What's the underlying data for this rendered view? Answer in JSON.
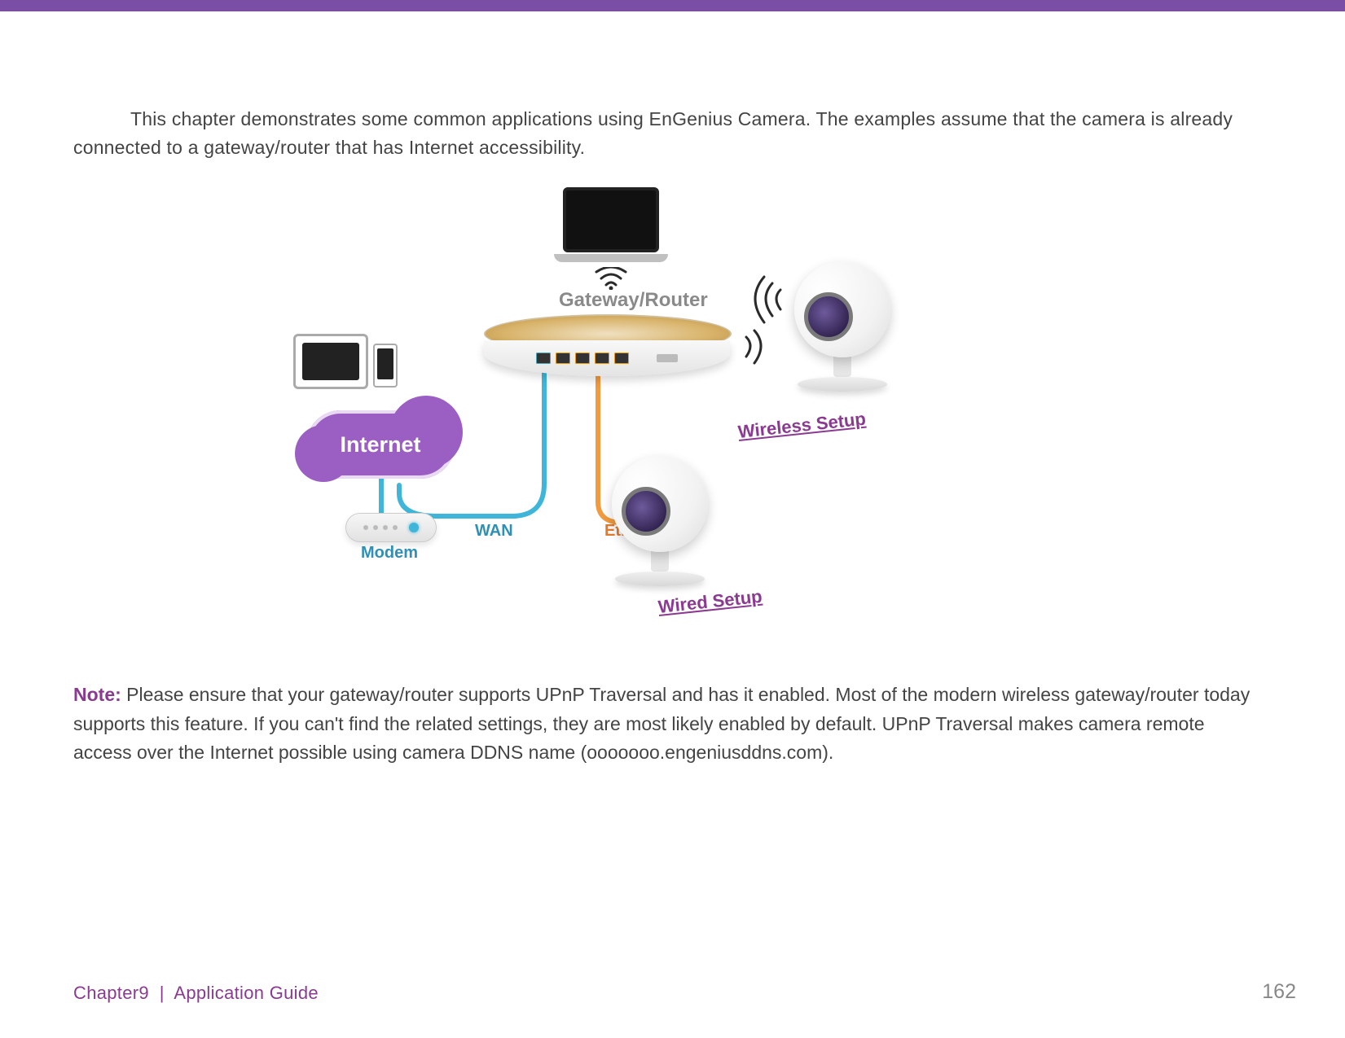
{
  "intro_text": "This chapter demonstrates some common applications using EnGenius Camera. The examples assume that the camera is already connected to a gateway/router that has Internet accessibility.",
  "note": {
    "label": "Note:",
    "text": "Please ensure that your gateway/router supports UPnP Traversal and has it enabled. Most of the modern wireless gateway/router today supports this feature. If you can't find the related settings, they are most likely enabled by default. UPnP Traversal makes camera remote access over the Internet possible using camera DDNS name (ooooooo.engeniusddns.com)."
  },
  "diagram": {
    "internet_label": "Internet",
    "gateway_label": "Gateway/Router",
    "wan_label": "WAN",
    "ethernet_label": "Ethernet",
    "modem_label": "Modem",
    "wireless_link": "Wireless Setup",
    "wired_link": "Wired Setup"
  },
  "footer": {
    "chapter": "Chapter9",
    "separator": "|",
    "section": "Application Guide"
  },
  "page_number": "162"
}
